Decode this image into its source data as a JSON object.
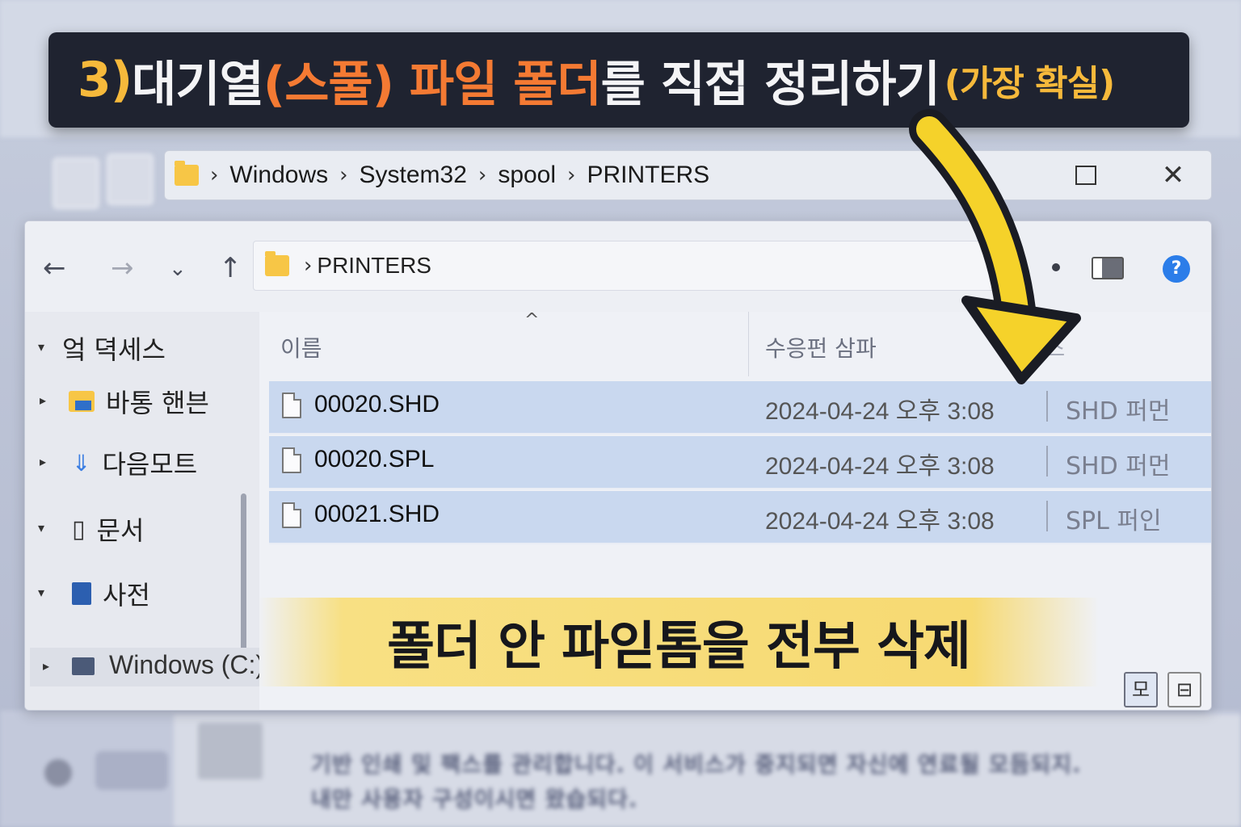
{
  "banner": {
    "part_num": "3) ",
    "part_white1": "대기열",
    "part_orange": "(스풀) 파일 폴더",
    "part_white2": "를 직접 정리하기",
    "part_small": "(가장 확실)"
  },
  "crumbbar": {
    "items": [
      "Windows",
      "System32",
      "spool",
      "PRINTERS"
    ]
  },
  "toolbar": {
    "address": "PRINTERS"
  },
  "sidebar": {
    "items": [
      {
        "label": "엌 뎍세스",
        "icon": "star-icon"
      },
      {
        "label": "바통 핸븐",
        "icon": "desktop-folder-icon"
      },
      {
        "label": "다음모트",
        "icon": "download-icon"
      },
      {
        "label": "문서",
        "icon": "document-icon"
      },
      {
        "label": "사전",
        "icon": "pictures-icon"
      },
      {
        "label": "Windows (C:)",
        "icon": "drive-icon"
      }
    ]
  },
  "columns": {
    "name": "이름",
    "date": "수응펀 삼파",
    "type": "이마스"
  },
  "files": [
    {
      "name": "00020.SHD",
      "date": "2024-04-24 오후 3:08",
      "type": "SHD 퍼먼"
    },
    {
      "name": "00020.SPL",
      "date": "2024-04-24 오후 3:08",
      "type": "SHD 퍼먼"
    },
    {
      "name": "00021.SHD",
      "date": "2024-04-24 오후 3:08",
      "type": "SPL 퍼인"
    }
  ],
  "caption": "폴더 안 파읻톰을 전부 삭제",
  "background_text": {
    "line1": "기반 인쇄 및 팩스를 관리합니다. 이 서비스가 중지되면 자신에 연료될 모듬되지.",
    "line2": "내만 사용자 구성이시면 왔습되다."
  },
  "view_buttons": {
    "details": "모",
    "tiles": "⊟"
  },
  "colors": {
    "banner_bg": "#1f2330",
    "accent_orange": "#f47a33",
    "accent_yellow": "#f6b93b",
    "arrow_yellow": "#f5d22a",
    "selection": "#c9d8ef",
    "folder": "#f7c646"
  }
}
